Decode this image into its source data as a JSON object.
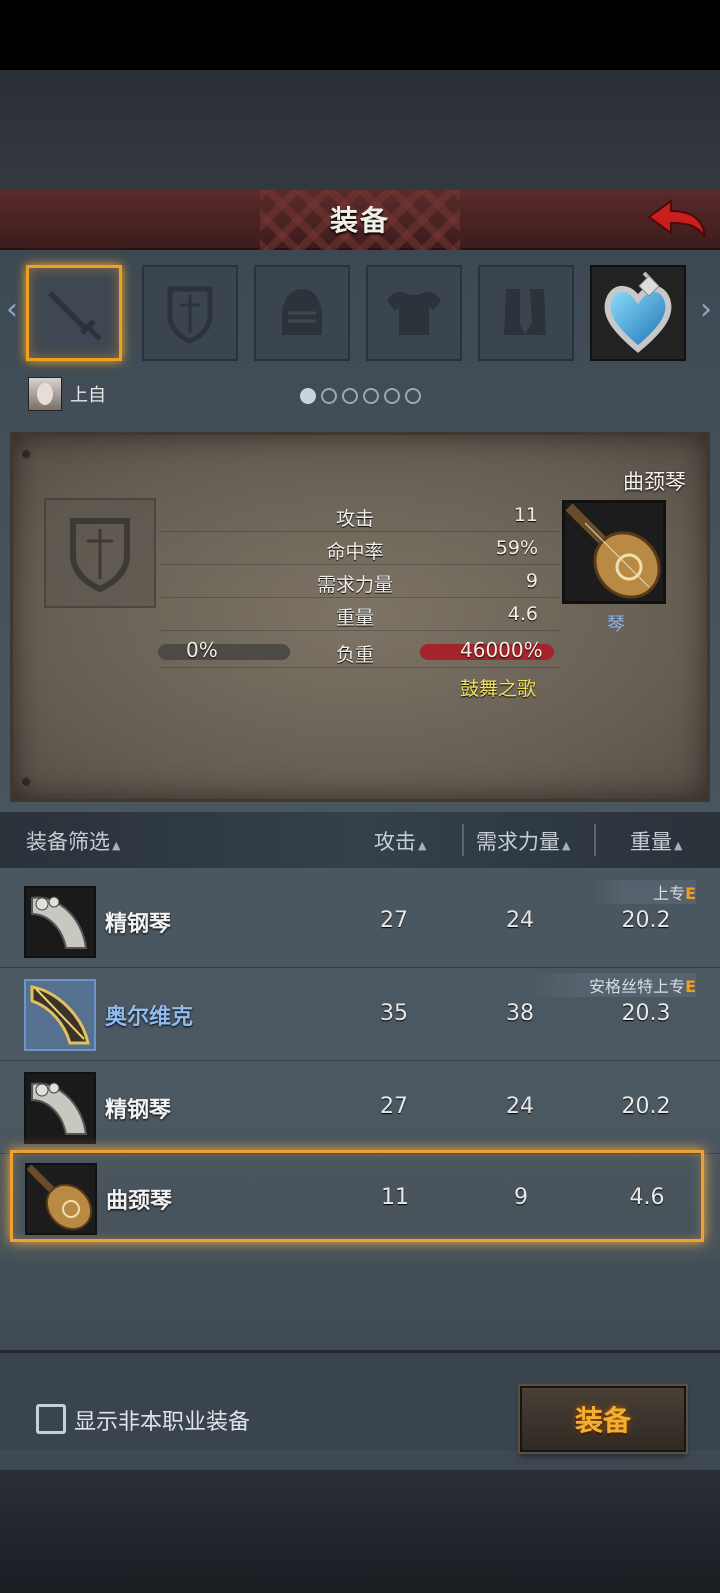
{
  "header": {
    "title": "装备"
  },
  "slots": [
    {
      "icon": "sword-icon",
      "selected": true
    },
    {
      "icon": "shield-icon"
    },
    {
      "icon": "helmet-icon"
    },
    {
      "icon": "armor-icon"
    },
    {
      "icon": "boots-icon"
    },
    {
      "icon": "heart-pendant-icon",
      "filled": true
    }
  ],
  "character": {
    "name": "上自"
  },
  "pager": {
    "pages": 6,
    "active": 0
  },
  "detail": {
    "item_name": "曲颈琴",
    "item_type": "琴",
    "stats": [
      {
        "label": "攻击",
        "value": "11"
      },
      {
        "label": "命中率",
        "value": "59%"
      },
      {
        "label": "需求力量",
        "value": "9"
      },
      {
        "label": "重量",
        "value": "4.6"
      }
    ],
    "load": {
      "label": "负重",
      "left_pct": "0%",
      "right_pct": "46000%"
    },
    "set_name": "鼓舞之歌"
  },
  "filter": {
    "filter_label": "装备筛选",
    "col_attack": "攻击",
    "col_strength": "需求力量",
    "col_weight": "重量"
  },
  "list": [
    {
      "name": "精钢琴",
      "attack": "27",
      "strength": "24",
      "weight": "20.2",
      "tag": "上专",
      "tag_grade": "E",
      "rarity": "normal"
    },
    {
      "name": "奥尔维克",
      "attack": "35",
      "strength": "38",
      "weight": "20.3",
      "tag": "安格丝特上专",
      "tag_grade": "E",
      "rarity": "blue"
    },
    {
      "name": "精钢琴",
      "attack": "27",
      "strength": "24",
      "weight": "20.2",
      "rarity": "normal"
    },
    {
      "name": "曲颈琴",
      "attack": "11",
      "strength": "9",
      "weight": "4.6",
      "rarity": "normal",
      "selected": true
    }
  ],
  "bottom": {
    "checkbox_label": "显示非本职业装备",
    "equip_button": "装备"
  },
  "colors": {
    "accent": "#f0a020",
    "header_red": "#5a2b2b",
    "rare_blue": "#8fbcf0"
  }
}
